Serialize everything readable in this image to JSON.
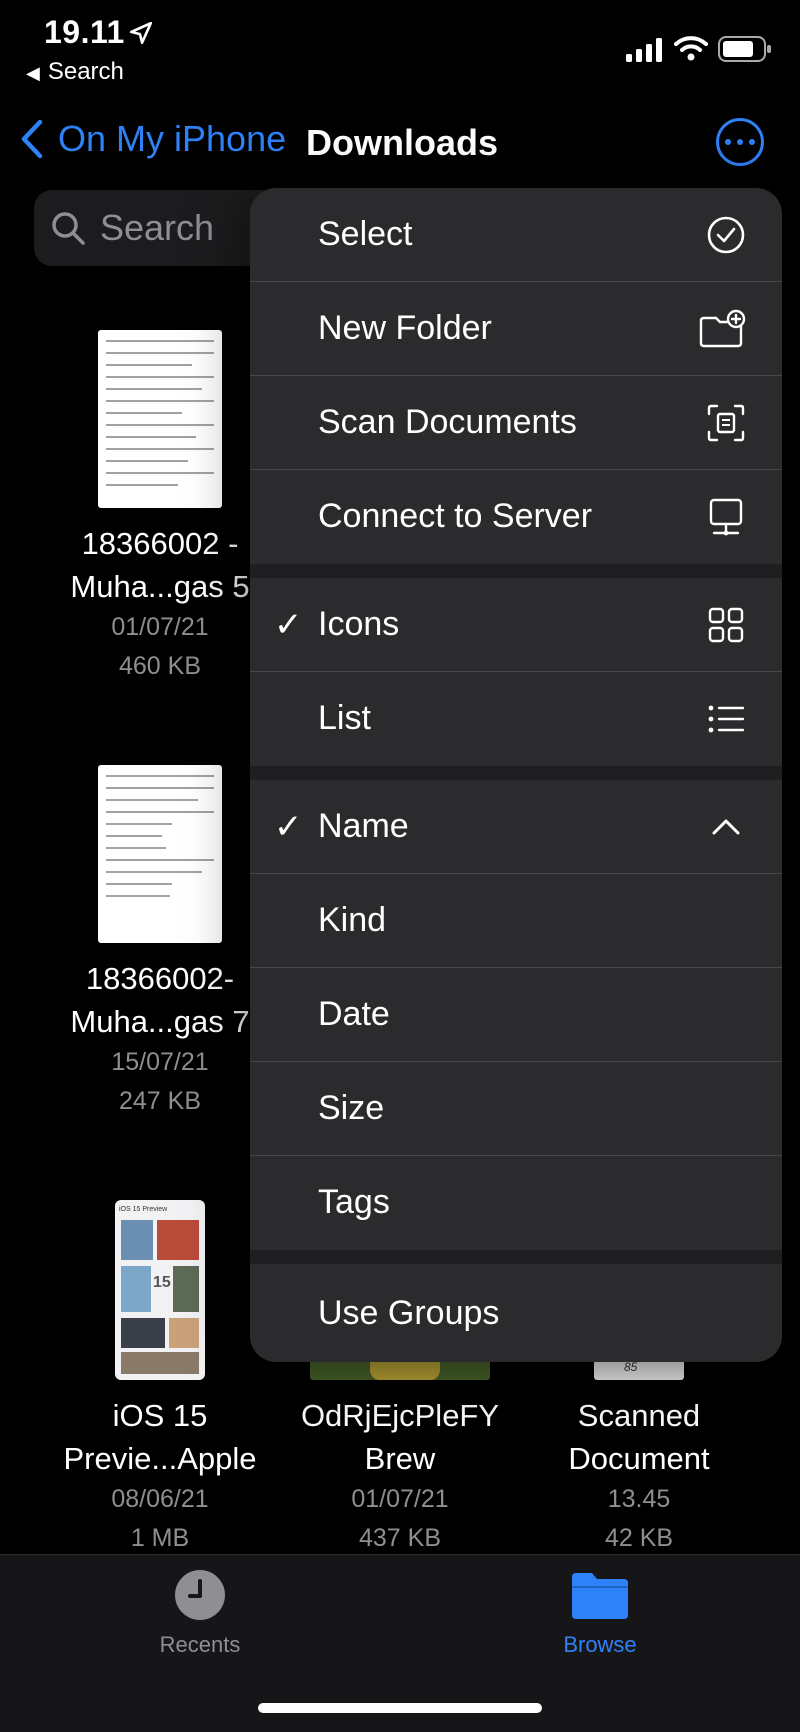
{
  "status": {
    "time": "19.11",
    "back_app": "Search"
  },
  "nav": {
    "back_label": "On My iPhone",
    "title": "Downloads"
  },
  "search": {
    "placeholder": "Search"
  },
  "files": [
    {
      "line1": "18366002 -",
      "line2": "Muha...gas 5",
      "date": "01/07/21",
      "size": "460 KB"
    },
    {
      "line1": "18366002-",
      "line2": "Muha...gas 7",
      "date": "15/07/21",
      "size": "247 KB"
    },
    {
      "line1": "iOS 15",
      "line2": "Previe...Apple",
      "date": "08/06/21",
      "size": "1 MB"
    },
    {
      "line1": "OdRjEjcPleFY",
      "line2": "Brew",
      "date": "01/07/21",
      "size": "437 KB"
    },
    {
      "line1": "Scanned",
      "line2": "Document",
      "date": "13.45",
      "size": "42 KB"
    }
  ],
  "thumb_text": {
    "ios_preview": "iOS 15 Preview",
    "ios_15": "15",
    "scanned_mark": "85"
  },
  "menu": {
    "select": "Select",
    "new_folder": "New Folder",
    "scan_documents": "Scan Documents",
    "connect_to_server": "Connect to Server",
    "icons": "Icons",
    "list": "List",
    "name": "Name",
    "kind": "Kind",
    "date": "Date",
    "size": "Size",
    "tags": "Tags",
    "use_groups": "Use Groups",
    "checkmark": "✓"
  },
  "tabs": {
    "recents": "Recents",
    "browse": "Browse"
  },
  "colors": {
    "accent": "#2f81f7",
    "menu_bg": "#2b2b2d",
    "secondary_text": "#8e8e93"
  }
}
